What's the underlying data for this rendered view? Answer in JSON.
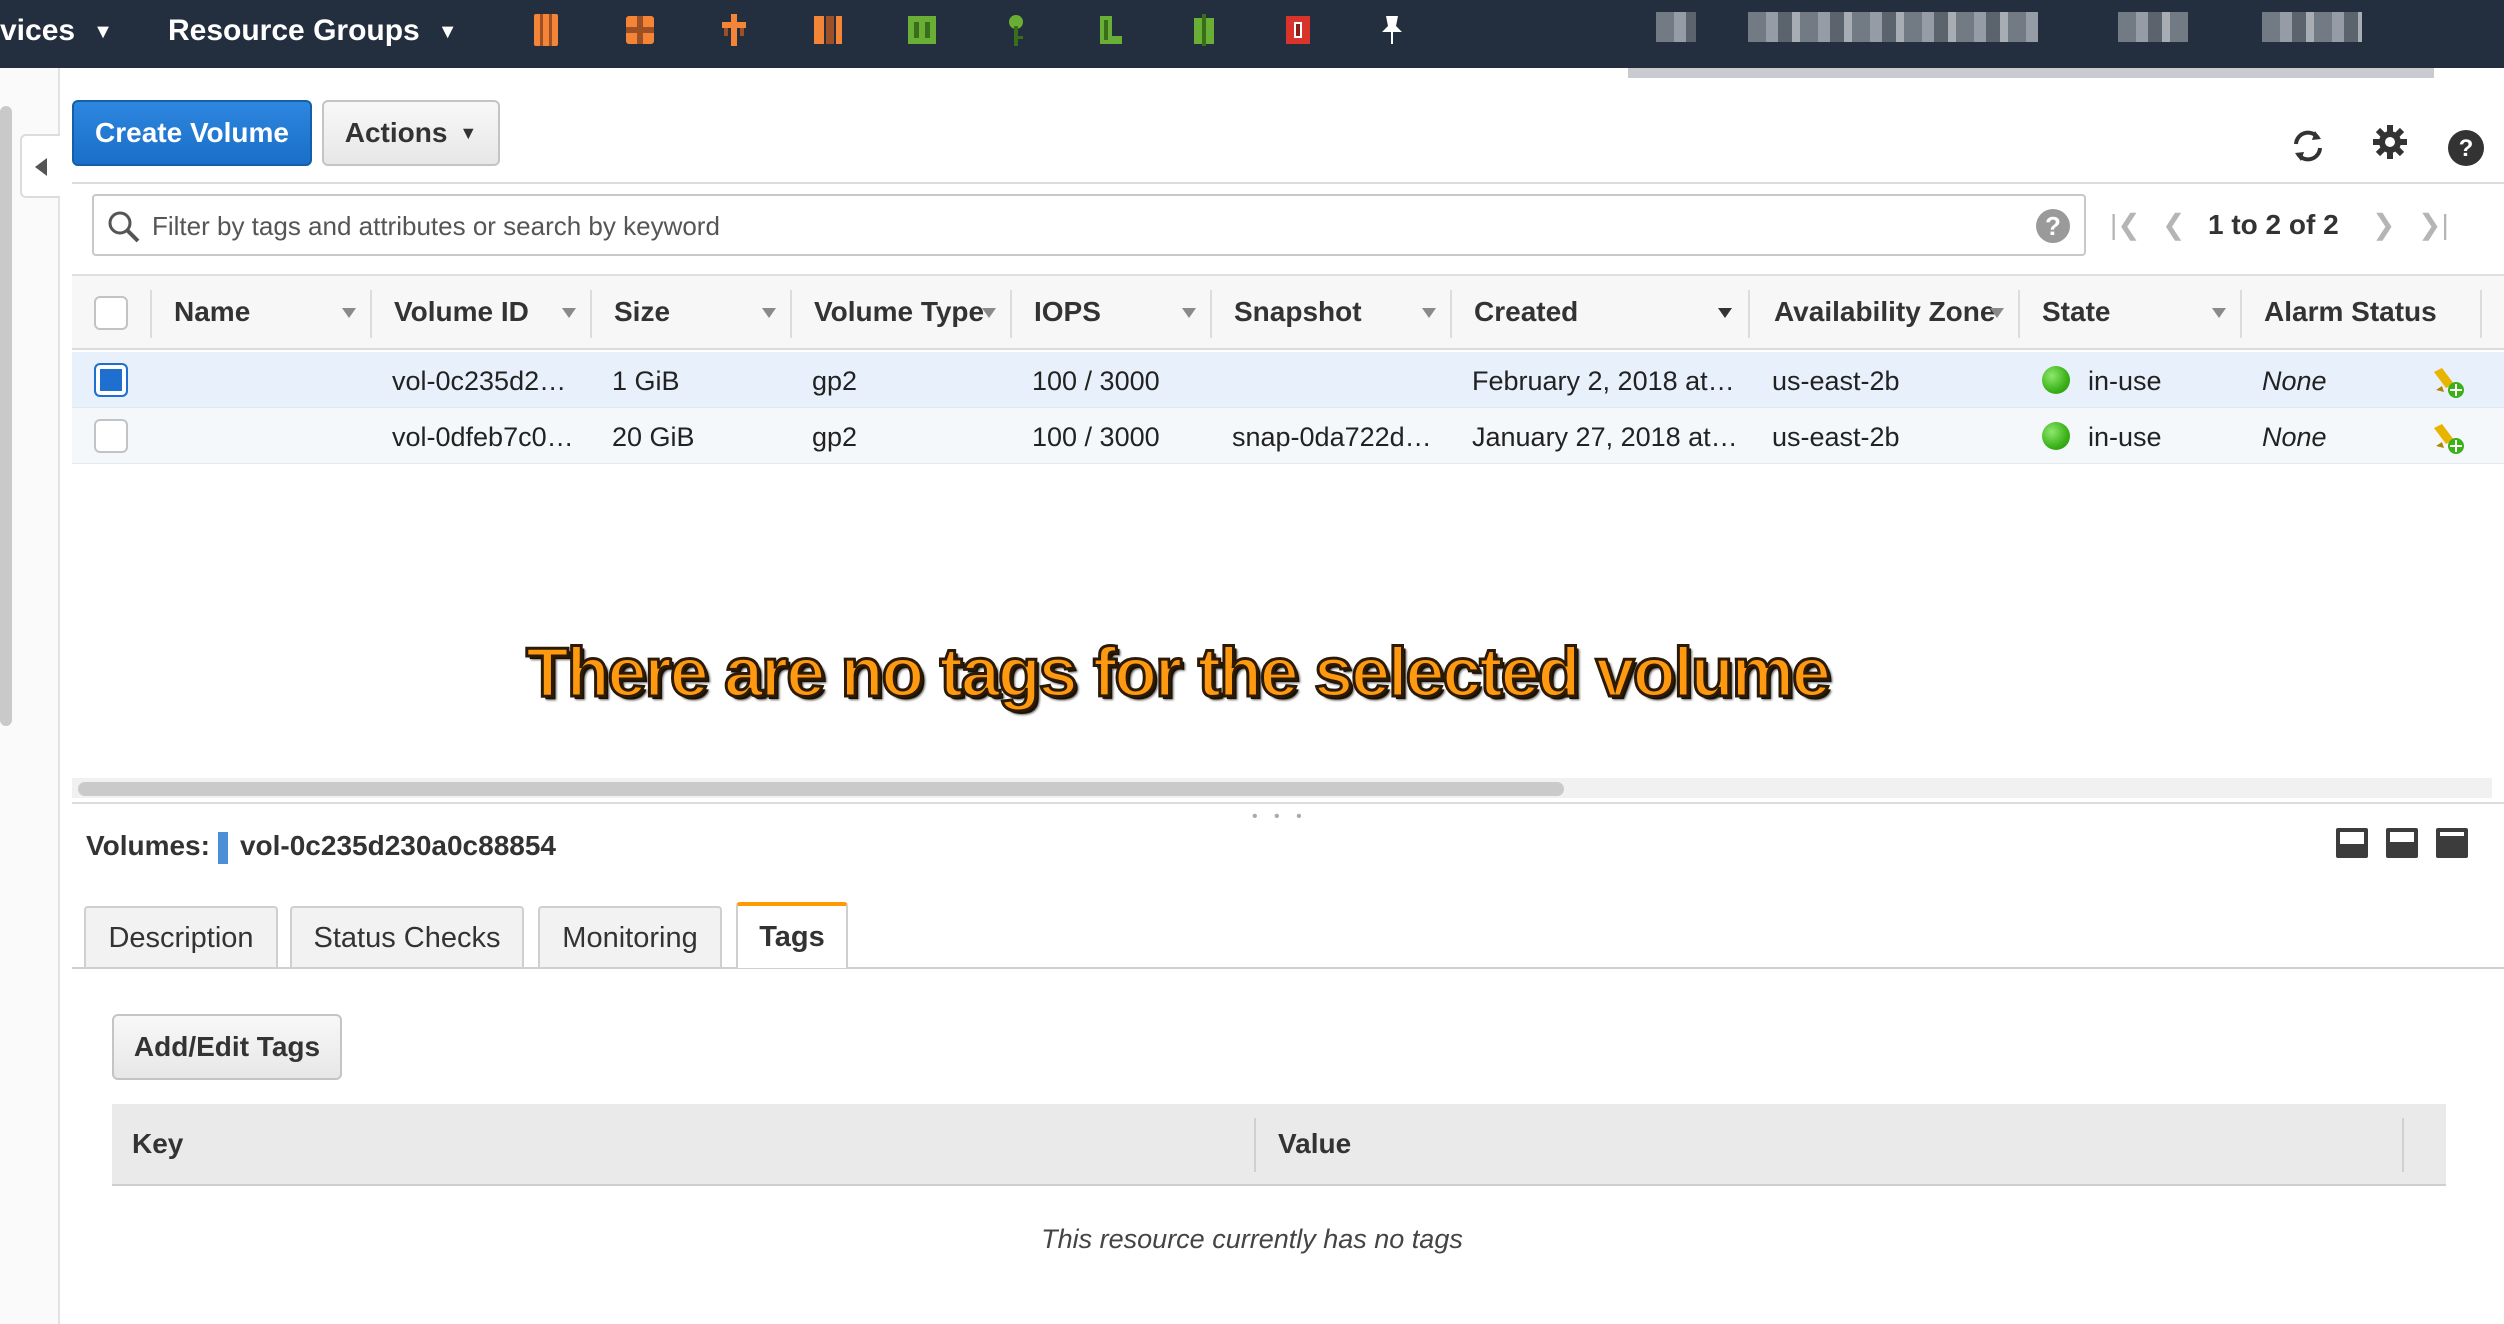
{
  "topnav": {
    "services_label": "vices",
    "resource_groups_label": "Resource Groups",
    "service_icons": [
      "ec2-icon",
      "ec2-box-icon",
      "lambda-icon",
      "ecs-icon",
      "lightsail-icon",
      "key-icon",
      "elastic-beanstalk-icon",
      "ecr-icon",
      "batch-icon",
      "pin-icon"
    ]
  },
  "toolbar": {
    "create_label": "Create Volume",
    "actions_label": "Actions"
  },
  "filter": {
    "placeholder": "Filter by tags and attributes or search by keyword",
    "pager": "1 to 2 of 2"
  },
  "table": {
    "columns": [
      "Name",
      "Volume ID",
      "Size",
      "Volume Type",
      "IOPS",
      "Snapshot",
      "Created",
      "Availability Zone",
      "State",
      "Alarm Status"
    ],
    "rows": [
      {
        "selected": true,
        "name": "",
        "volume_id": "vol-0c235d2…",
        "size": "1 GiB",
        "type": "gp2",
        "iops": "100 / 3000",
        "snapshot": "",
        "created": "February 2, 2018 at…",
        "az": "us-east-2b",
        "state": "in-use",
        "alarm": "None"
      },
      {
        "selected": false,
        "name": "",
        "volume_id": "vol-0dfeb7c0…",
        "size": "20 GiB",
        "type": "gp2",
        "iops": "100 / 3000",
        "snapshot": "snap-0da722d…",
        "created": "January 27, 2018 at…",
        "az": "us-east-2b",
        "state": "in-use",
        "alarm": "None"
      }
    ]
  },
  "annotation": "There are no tags for the selected volume",
  "details": {
    "label": "Volumes:",
    "volume_id": "vol-0c235d230a0c88854",
    "tabs": [
      "Description",
      "Status Checks",
      "Monitoring",
      "Tags"
    ],
    "active_tab": "Tags",
    "add_edit_label": "Add/Edit Tags",
    "tag_columns": [
      "Key",
      "Value"
    ],
    "empty_message": "This resource currently has no tags"
  },
  "colors": {
    "nav_bg": "#232f3e",
    "primary_button": "#1a6fc6",
    "active_tab_accent": "#ff9900",
    "state_ok": "#3bb118",
    "annotation": "#ff9a10"
  }
}
